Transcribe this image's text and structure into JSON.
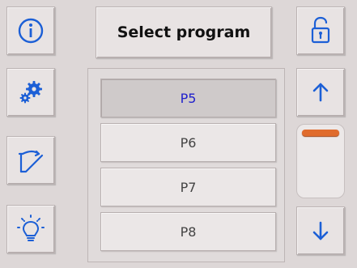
{
  "header": {
    "title": "Select program"
  },
  "programs": [
    {
      "label": "P5",
      "selected": true
    },
    {
      "label": "P6",
      "selected": false
    },
    {
      "label": "P7",
      "selected": false
    },
    {
      "label": "P8",
      "selected": false
    }
  ],
  "scrollbar": {
    "position": 0.0
  },
  "icons": {
    "info": "info-icon",
    "settings": "gears-icon",
    "trajectory": "trajectory-icon",
    "light": "lightbulb-icon",
    "lock": "unlocked-padlock-icon",
    "up": "arrow-up-icon",
    "down": "arrow-down-icon"
  },
  "colors": {
    "icon_blue": "#1c5fd6",
    "selected_text": "#2222cc",
    "scroll_thumb": "#e06b2c"
  }
}
